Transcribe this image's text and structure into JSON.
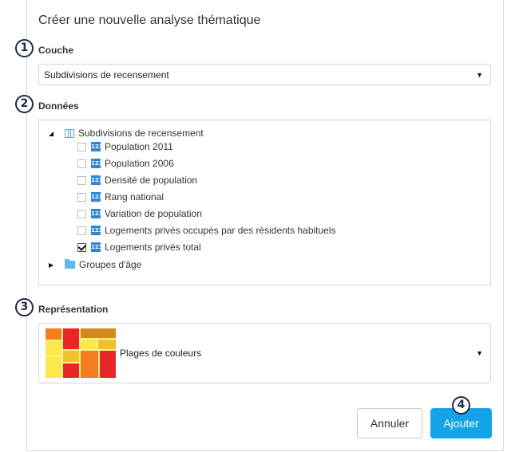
{
  "dialog": {
    "title": "Créer une nouvelle analyse thématique"
  },
  "steps": {
    "one": "1",
    "two": "2",
    "three": "3",
    "four": "4"
  },
  "couche": {
    "label": "Couche",
    "selected": "Subdivisions de recensement",
    "arrow": "▼"
  },
  "donnees": {
    "label": "Données",
    "root": {
      "toggle": "◢",
      "label": "Subdivisions de recensement",
      "icon": "table-icon"
    },
    "items": [
      {
        "label": "Population 2011",
        "checked": false
      },
      {
        "label": "Population 2006",
        "checked": false
      },
      {
        "label": "Densité de population",
        "checked": false
      },
      {
        "label": "Rang national",
        "checked": false
      },
      {
        "label": "Variation de population",
        "checked": false
      },
      {
        "label": "Logements privés occupés par des résidents habituels",
        "checked": false
      },
      {
        "label": "Logements privés total",
        "checked": true
      }
    ],
    "item_icon_text": "123",
    "group": {
      "toggle": "▶",
      "label": "Groupes d'âge",
      "icon": "folder-icon"
    }
  },
  "representation": {
    "label": "Représentation",
    "selected": "Plages de couleurs",
    "arrow": "▼",
    "thumbnail_colors": [
      "#e8262a",
      "#f57c1f",
      "#f2c12e",
      "#fbe84a",
      "#fdf38a",
      "#d4891a"
    ]
  },
  "buttons": {
    "cancel": "Annuler",
    "add": "Ajouter"
  },
  "colors": {
    "accent": "#13a4e8",
    "badge": "#1f2a44"
  }
}
